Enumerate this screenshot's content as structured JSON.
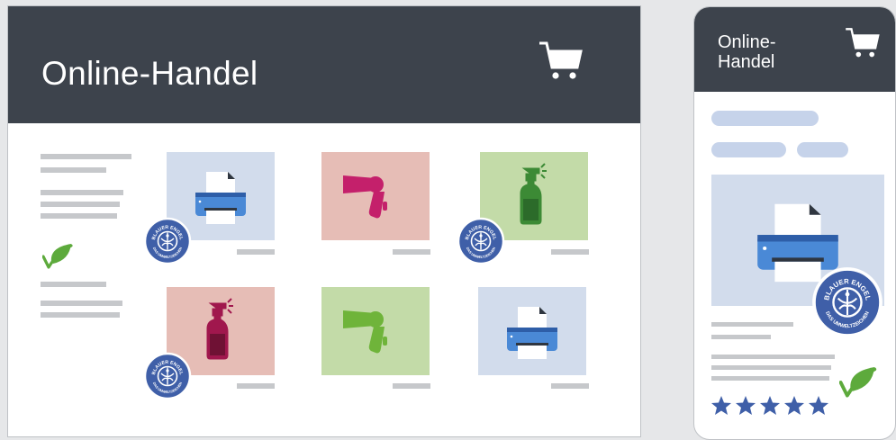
{
  "desktop": {
    "title": "Online-Handel",
    "header_color": "#3d434c",
    "tiles": [
      {
        "product": "printer",
        "bg": "#d2dcec",
        "eco_label": true
      },
      {
        "product": "hair-dryer",
        "bg": "#e6bdb6",
        "eco_label": false,
        "color": "#c4206b"
      },
      {
        "product": "spray-bottle",
        "bg": "#c3dba8",
        "eco_label": true,
        "color": "#3c8a35"
      },
      {
        "product": "spray-bottle",
        "bg": "#e6bdb6",
        "eco_label": true,
        "color": "#a0174d"
      },
      {
        "product": "hair-dryer",
        "bg": "#c3dba8",
        "eco_label": false,
        "color": "#6fb43a"
      },
      {
        "product": "printer",
        "bg": "#d2dcec",
        "eco_label": false
      }
    ]
  },
  "mobile": {
    "title": "Online-Handel",
    "rating_stars": 5,
    "product": "printer",
    "eco_label": true
  },
  "eco_label": {
    "top_text": "BLAUER ENGEL",
    "bottom_text": "DAS UMWELTZEICHEN",
    "color": "#3f5fa8"
  },
  "colors": {
    "star": "#3f5fa8",
    "leaf": "#5daa3c",
    "placeholder_bar": "#c6c8cb",
    "placeholder_pill": "#c6d3ea"
  }
}
